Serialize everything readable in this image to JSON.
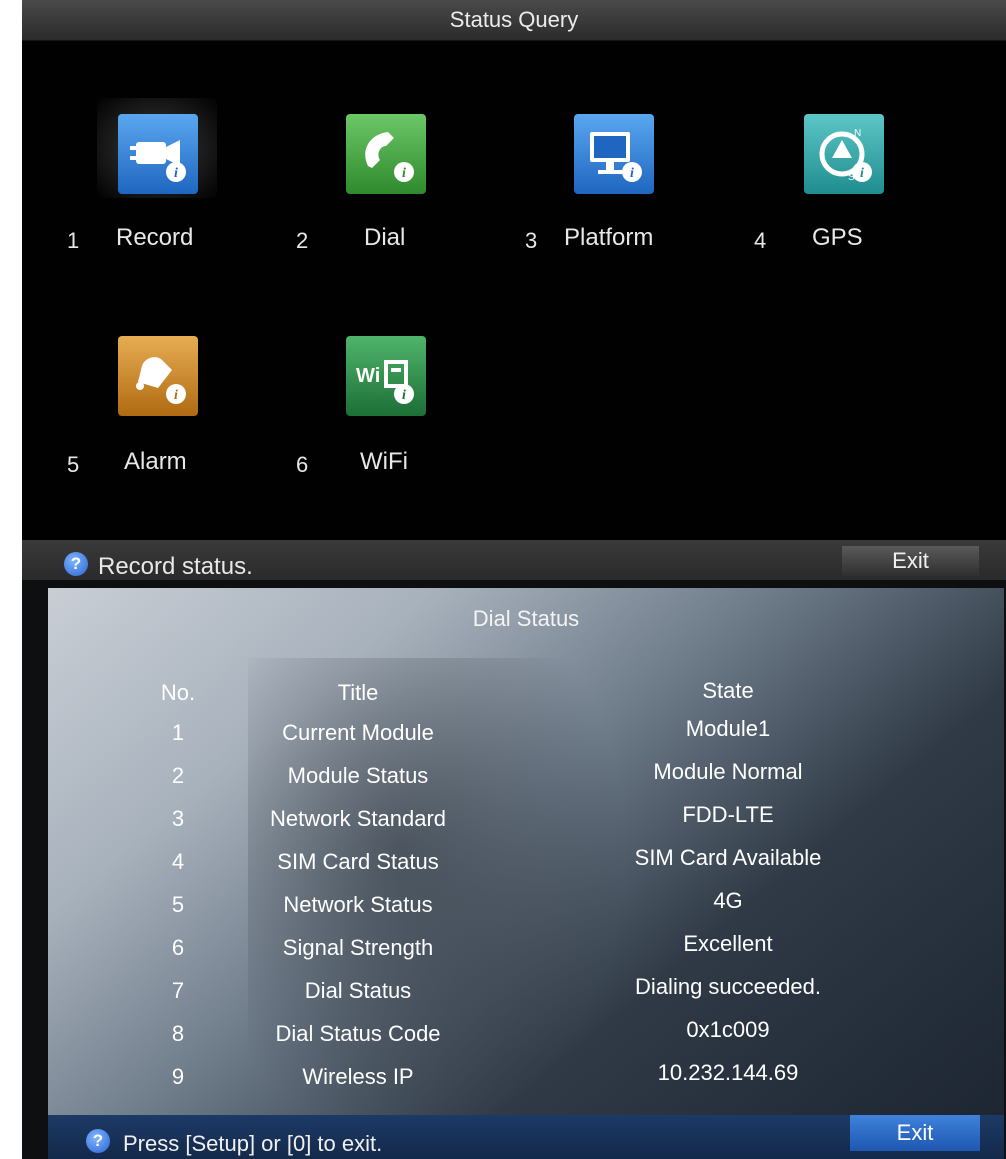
{
  "status_query": {
    "title": "Status Query",
    "tiles": [
      {
        "number": "1",
        "label": "Record",
        "icon": "record-camera-icon",
        "color": "#2d7bd0",
        "selected": true
      },
      {
        "number": "2",
        "label": "Dial",
        "icon": "phone-icon",
        "color": "#3f9b3c"
      },
      {
        "number": "3",
        "label": "Platform",
        "icon": "platform-monitor-icon",
        "color": "#2d7bd0"
      },
      {
        "number": "4",
        "label": "GPS",
        "icon": "gps-compass-icon",
        "color": "#2e9ea0"
      },
      {
        "number": "5",
        "label": "Alarm",
        "icon": "alarm-bell-icon",
        "color": "#c58425"
      },
      {
        "number": "6",
        "label": "WiFi",
        "icon": "wifi-icon",
        "color": "#2f8a45"
      }
    ],
    "status_text": "Record status.",
    "exit_label": "Exit"
  },
  "dial_status": {
    "title": "Dial Status",
    "columns": {
      "no": "No.",
      "title": "Title",
      "state": "State"
    },
    "rows": [
      {
        "no": "1",
        "title": "Current Module",
        "state": "Module1"
      },
      {
        "no": "2",
        "title": "Module Status",
        "state": "Module Normal"
      },
      {
        "no": "3",
        "title": "Network Standard",
        "state": "FDD-LTE"
      },
      {
        "no": "4",
        "title": "SIM Card Status",
        "state": "SIM Card Available"
      },
      {
        "no": "5",
        "title": "Network Status",
        "state": "4G"
      },
      {
        "no": "6",
        "title": "Signal Strength",
        "state": "Excellent"
      },
      {
        "no": "7",
        "title": "Dial Status",
        "state": "Dialing succeeded."
      },
      {
        "no": "8",
        "title": "Dial Status Code",
        "state": "0x1c009"
      },
      {
        "no": "9",
        "title": "Wireless IP",
        "state": "10.232.144.69"
      }
    ],
    "hint_text": "Press [Setup] or [0] to exit.",
    "exit_label": "Exit"
  }
}
